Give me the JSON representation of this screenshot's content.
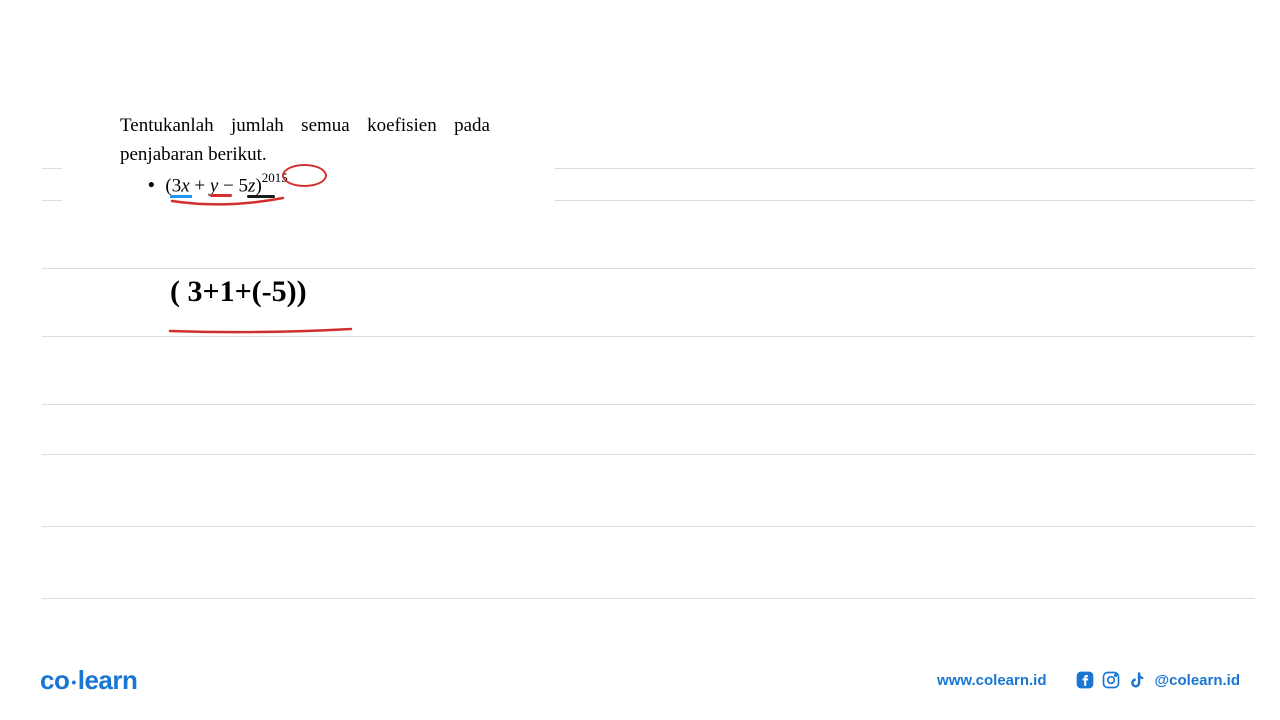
{
  "problem": {
    "instruction": "Tentukanlah jumlah semua koefisien pada penjabaran berikut.",
    "expression_open": "(3",
    "var_x": "x",
    "plus": " + ",
    "var_y": "y",
    "minus": " − 5",
    "var_z": "z",
    "close": ")",
    "exponent": "2015"
  },
  "handwritten": {
    "formula": "( 3+1+(-5))"
  },
  "footer": {
    "logo_co": "co",
    "logo_learn": "learn",
    "website": "www.colearn.id",
    "handle": "@colearn.id"
  },
  "colors": {
    "brand_blue": "#1976d2",
    "annotation_red": "#d32f2f",
    "annotation_blue": "#2196f3"
  }
}
